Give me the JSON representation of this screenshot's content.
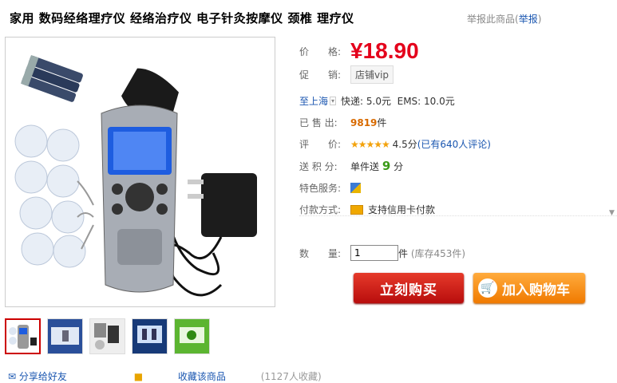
{
  "product": {
    "title": "家用 数码经络理疗仪 经络治疗仪 电子针灸按摩仪 颈椎 理疗仪",
    "report_prefix": "举报此商品(",
    "report_link": "举报",
    "report_suffix": ")"
  },
  "price": {
    "label": "价　　格:",
    "value": "¥18.90"
  },
  "promo": {
    "label": "促　　销:",
    "tag": "店铺vip"
  },
  "shipping": {
    "to": "至上海",
    "express": "快递: 5.0元",
    "ems": "EMS: 10.0元"
  },
  "sold": {
    "label": "已 售 出:",
    "count": "9819",
    "unit": "件"
  },
  "rating": {
    "label": "评　　价:",
    "stars": "★★★★★",
    "score": "4.5分",
    "reviews": "(已有640人评论)"
  },
  "points": {
    "label": "送 积 分:",
    "prefix": "单件送",
    "value": "9",
    "unit": "分"
  },
  "service": {
    "label": "特色服务:"
  },
  "payment": {
    "label": "付款方式:",
    "method": "支持信用卡付款"
  },
  "quantity": {
    "label": "数　　量:",
    "value": "1",
    "unit": "件",
    "stock": "(库存453件)"
  },
  "buttons": {
    "buy": "立刻购买",
    "cart": "加入购物车"
  },
  "bottom": {
    "share": "分享给好友",
    "fav": "收藏该商品",
    "fav_count": "(1127人收藏)"
  },
  "colors": {
    "price": "#e4001b",
    "buy": "#c4161c",
    "cart": "#f48b13",
    "link": "#1a56b0"
  }
}
